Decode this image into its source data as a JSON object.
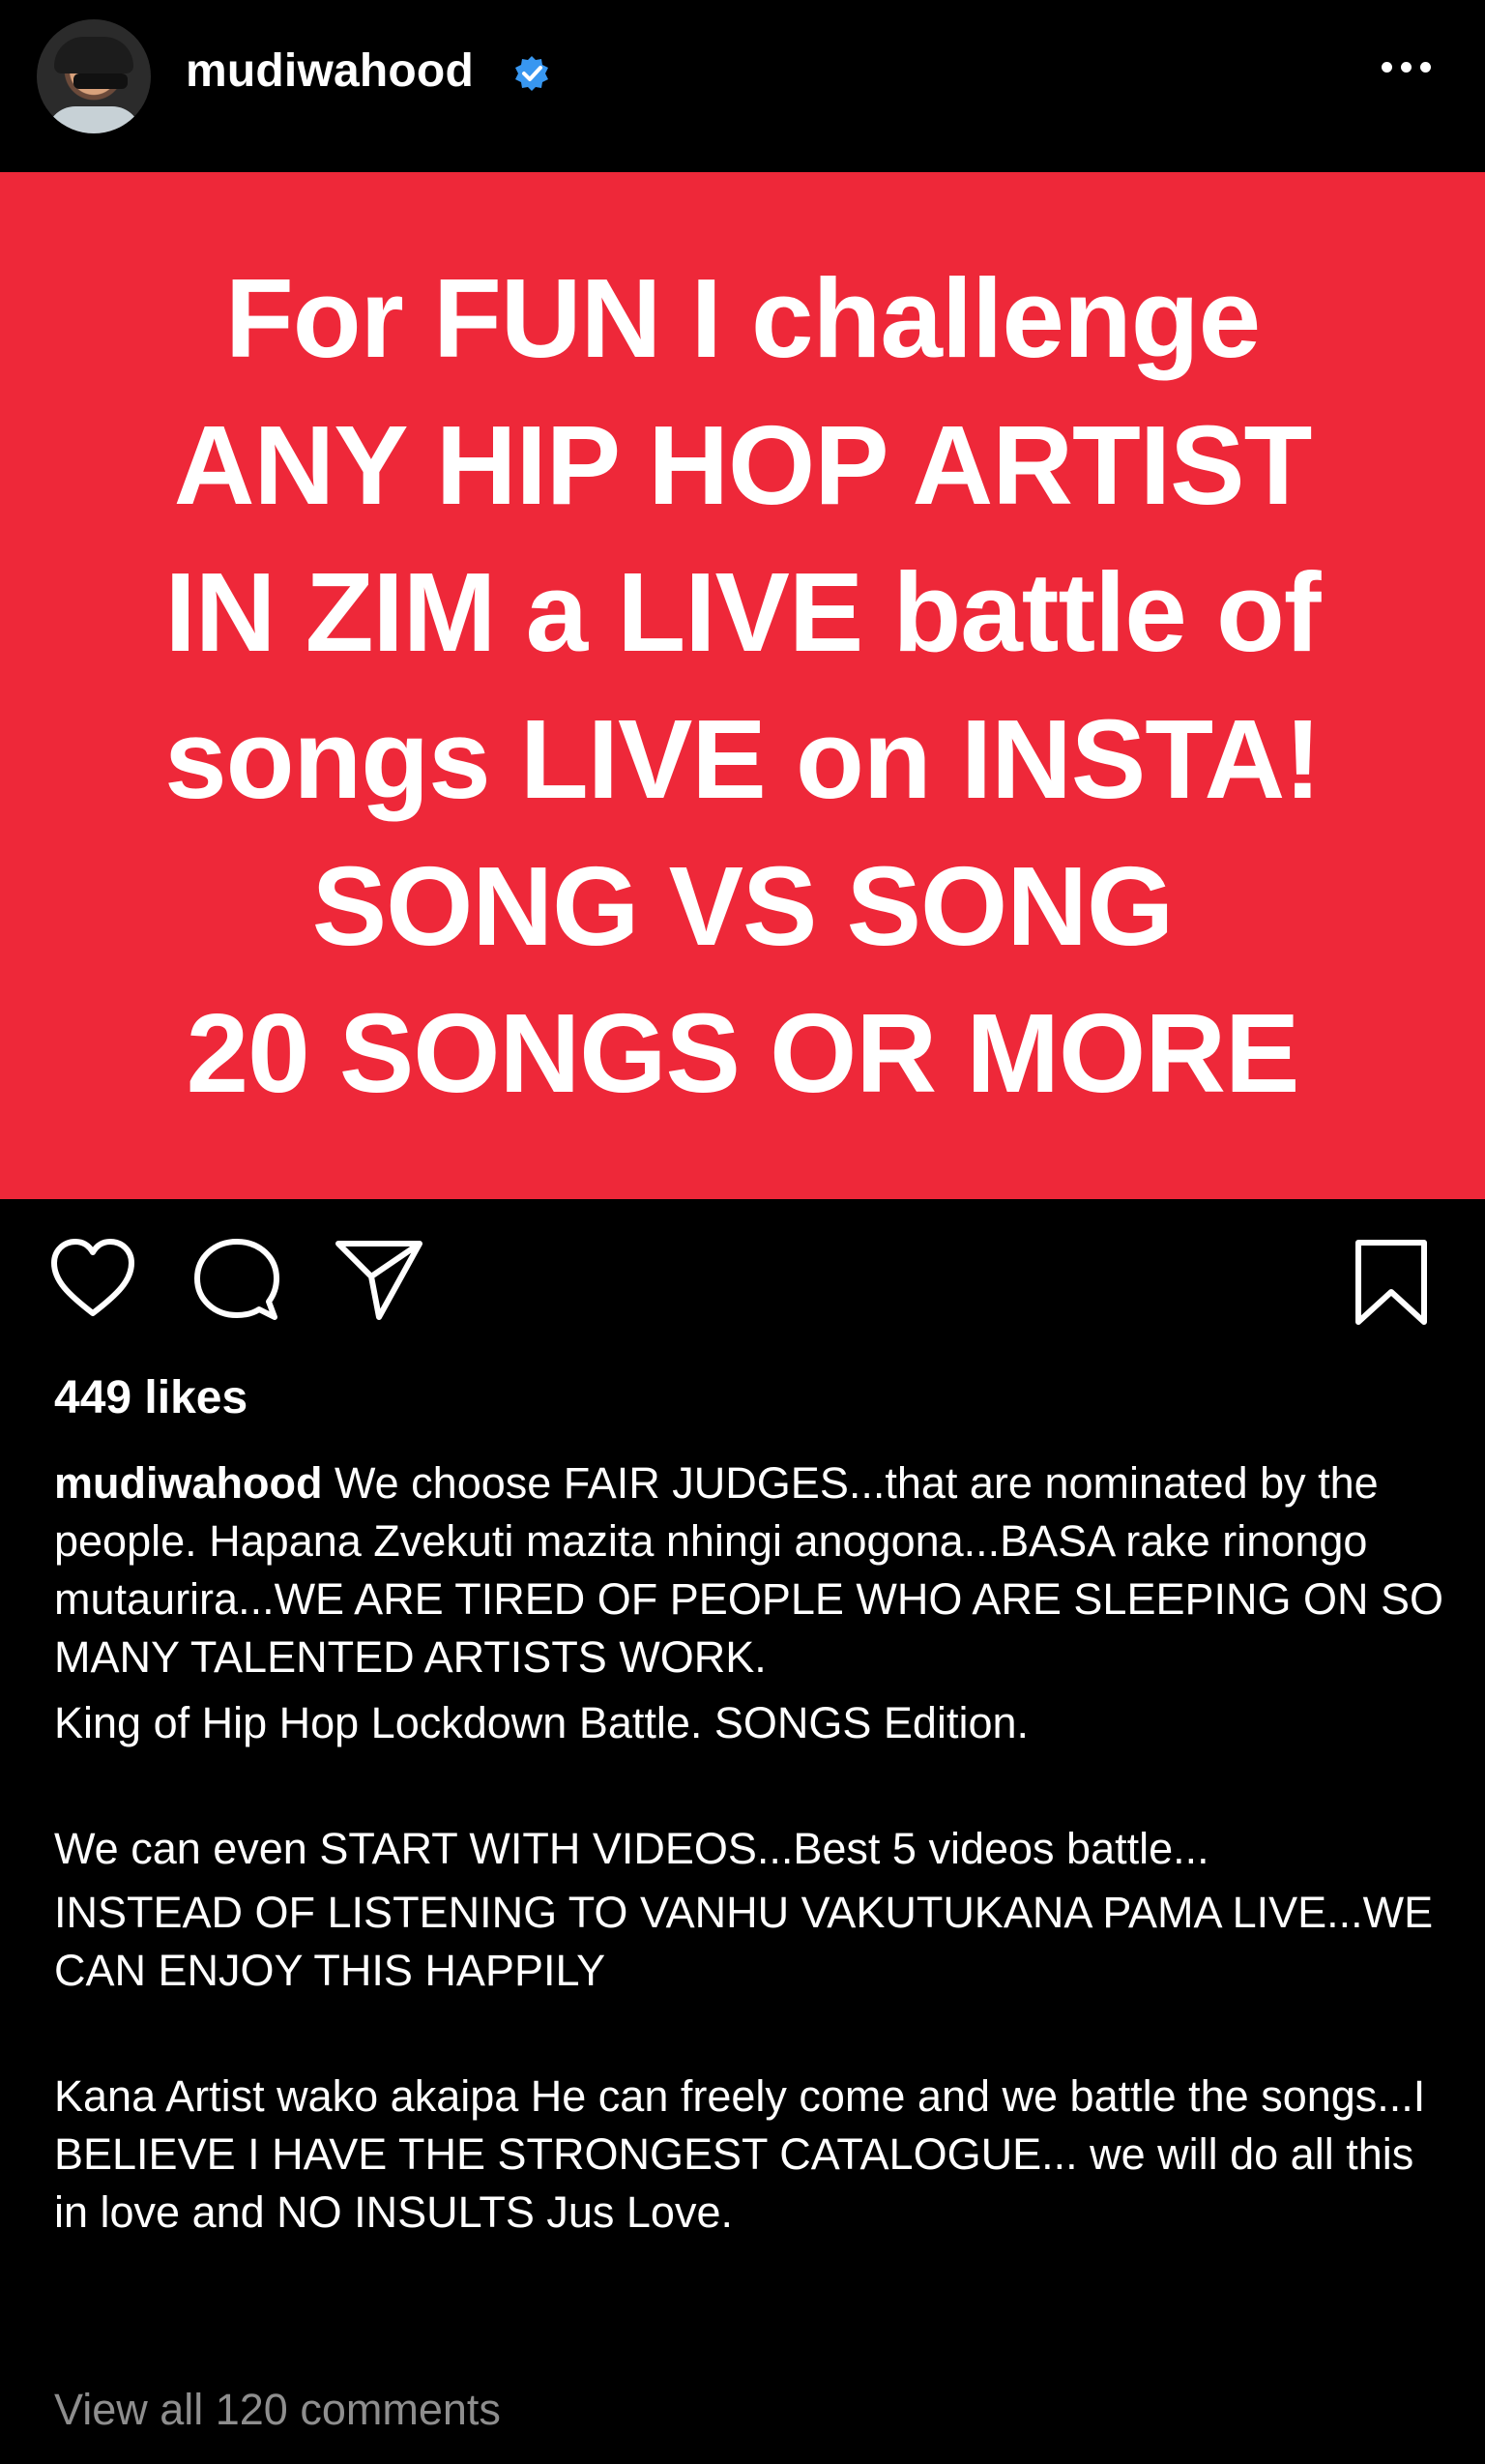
{
  "post": {
    "username": "mudiwahood",
    "verified": true,
    "avatar_icon": "profile-photo",
    "more_icon": "more-options-icon"
  },
  "banner": {
    "background": "#ee2839",
    "lines": [
      "For FUN I challenge",
      "ANY HIP HOP ARTIST",
      "IN ZIM a LIVE battle of",
      "songs LIVE on INSTA!",
      "SONG VS SONG",
      "20 SONGS OR MORE"
    ]
  },
  "actions": {
    "like_icon": "heart-icon",
    "comment_icon": "comment-bubble-icon",
    "share_icon": "paper-plane-icon",
    "save_icon": "bookmark-icon"
  },
  "likes": "449 likes",
  "caption": {
    "username": "mudiwahood",
    "text1": " We choose FAIR JUDGES...that are nominated by the people. Hapana Zvekuti mazita nhingi anogona...BASA rake rinongo mutaurira...WE ARE TIRED OF PEOPLE WHO ARE SLEEPING ON SO MANY TALENTED ARTISTS WORK.",
    "text2": "King of Hip Hop Lockdown Battle. SONGS Edition.",
    "text3": "We can even START WITH VIDEOS...Best 5 videos battle...",
    "text4": "INSTEAD OF LISTENING TO VANHU VAKUTUKANA PAMA LIVE...WE CAN ENJOY THIS HAPPILY",
    "text5": "Kana Artist wako akaipa He can freely come and we battle the songs...I BELIEVE I HAVE THE STRONGEST CATALOGUE... we will do all this in love and NO INSULTS Jus Love."
  },
  "view_all_comments": "View all 120 comments"
}
